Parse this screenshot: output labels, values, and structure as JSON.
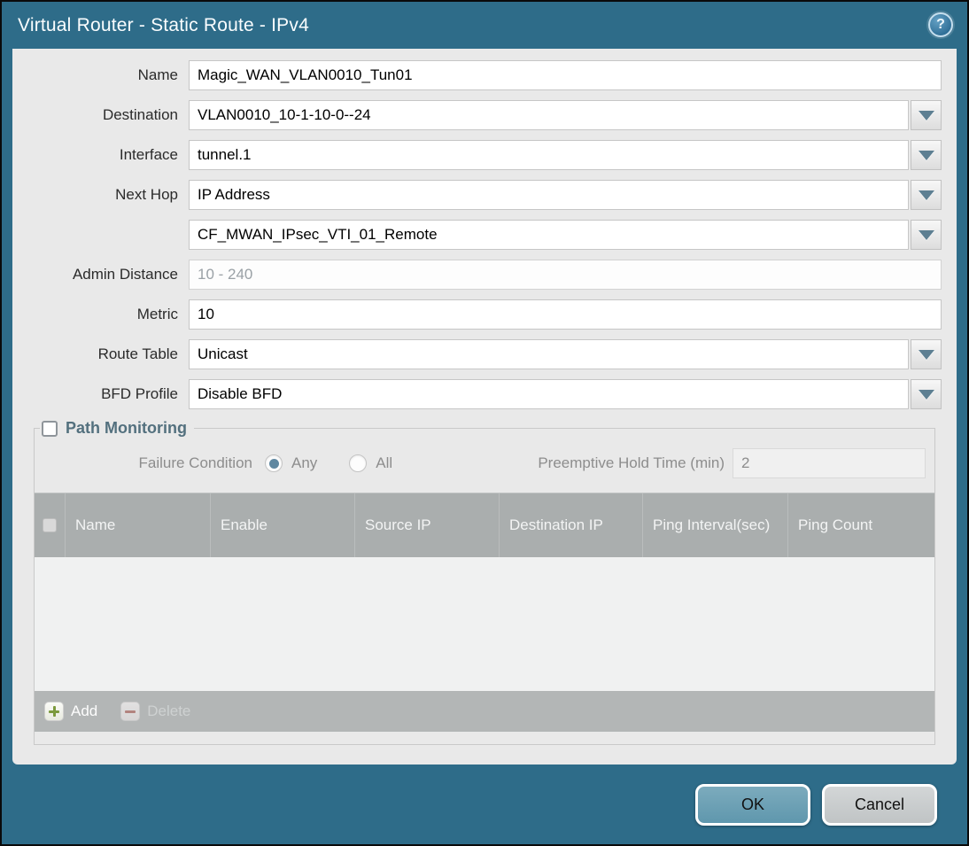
{
  "window": {
    "title": "Virtual Router - Static Route - IPv4"
  },
  "icons": {
    "help": "question-mark-circle",
    "dropdown": "chevron-down",
    "add": "plus",
    "delete": "minus"
  },
  "form": {
    "name": {
      "label": "Name",
      "value": "Magic_WAN_VLAN0010_Tun01"
    },
    "destination": {
      "label": "Destination",
      "value": "VLAN0010_10-1-10-0--24"
    },
    "interface": {
      "label": "Interface",
      "value": "tunnel.1"
    },
    "next_hop": {
      "label": "Next Hop",
      "value": "IP Address"
    },
    "next_hop_address": {
      "value": "CF_MWAN_IPsec_VTI_01_Remote"
    },
    "admin_distance": {
      "label": "Admin Distance",
      "placeholder": "10 - 240",
      "value": ""
    },
    "metric": {
      "label": "Metric",
      "value": "10"
    },
    "route_table": {
      "label": "Route Table",
      "value": "Unicast"
    },
    "bfd_profile": {
      "label": "BFD Profile",
      "value": "Disable BFD"
    }
  },
  "path_monitoring": {
    "legend": "Path Monitoring",
    "enabled": false,
    "failure_condition": {
      "label": "Failure Condition",
      "options": [
        {
          "label": "Any",
          "selected": true
        },
        {
          "label": "All",
          "selected": false
        }
      ]
    },
    "preemptive_hold_time": {
      "label": "Preemptive Hold Time (min)",
      "value": "2"
    },
    "table": {
      "columns": [
        "Name",
        "Enable",
        "Source IP",
        "Destination IP",
        "Ping Interval(sec)",
        "Ping Count"
      ],
      "rows": [],
      "add_label": "Add",
      "delete_label": "Delete"
    }
  },
  "footer": {
    "ok_label": "OK",
    "cancel_label": "Cancel"
  },
  "help_symbol": "?",
  "colors": {
    "titlebar": "#2e6c89",
    "content_bg": "#e9e9e9",
    "table_header_bg": "#aaaeae",
    "ok_button": "#69a0b5",
    "cancel_button": "#c9cccd",
    "add_green": "#7c9a3d",
    "delete_red": "#b2736c",
    "dropdown_arrow": "#5d7f92"
  }
}
